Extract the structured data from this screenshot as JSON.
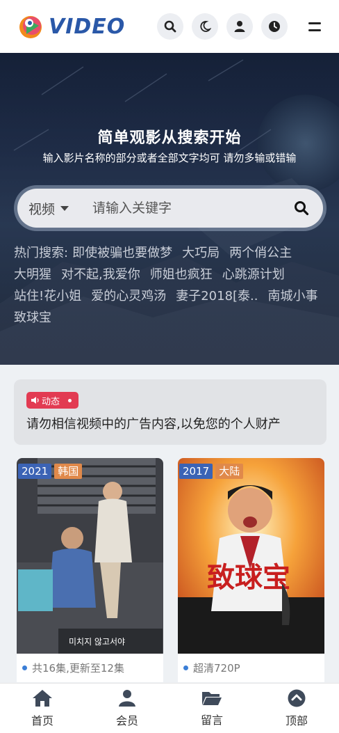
{
  "header": {
    "logo_text": "VIDEO",
    "buttons": [
      "search-icon",
      "moon-icon",
      "user-icon",
      "clock-icon",
      "menu-icon"
    ]
  },
  "hero": {
    "title": "简单观影从搜索开始",
    "subtitle": "输入影片名称的部分或者全部文字均可 请勿多输或错输",
    "search": {
      "type_label": "视频",
      "placeholder": "请输入关键字"
    },
    "hot_label": "热门搜索:",
    "hot_items": [
      "即使被骗也要做梦",
      "大巧局",
      "两个俏公主",
      "大明猩",
      "对不起,我爱你",
      "师姐也疯狂",
      "心跳源计划",
      "站住!花小姐",
      "爱的心灵鸡汤",
      "妻子2018[泰..",
      "南城小事",
      "致球宝"
    ]
  },
  "notice": {
    "badge": "动态",
    "text": "请勿相信视频中的广告内容,以免您的个人财产"
  },
  "cards": [
    {
      "year": "2021",
      "area": "韩国",
      "status": "共16集,更新至12集",
      "poster_caption": "미치지 않고서야"
    },
    {
      "year": "2017",
      "area": "大陆",
      "status": "超清720P",
      "poster_caption": "致球宝"
    }
  ],
  "nav": [
    {
      "label": "首页",
      "icon": "home-icon"
    },
    {
      "label": "会员",
      "icon": "user-icon"
    },
    {
      "label": "留言",
      "icon": "folder-icon"
    },
    {
      "label": "顶部",
      "icon": "arrow-up-icon"
    }
  ],
  "colors": {
    "accent": "#2a58a8",
    "badge": "#e23b52",
    "year_tag": "#3b63b5",
    "area_tag": "#e0894a"
  }
}
